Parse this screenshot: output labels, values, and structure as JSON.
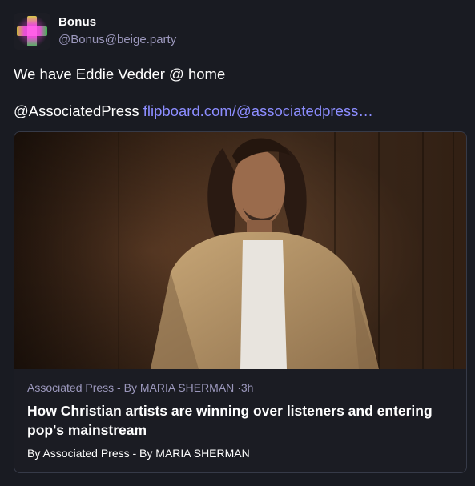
{
  "account": {
    "display_name": "Bonus",
    "handle": "@Bonus@beige.party",
    "avatar_icon": "pink-cross-avatar"
  },
  "status": {
    "line1": "We have Eddie Vedder @ home",
    "mention": "@AssociatedPress",
    "link_text": "flipboard.com/@associatedpress…"
  },
  "card": {
    "provider": "Associated Press - By MARIA SHERMAN",
    "separator": "·",
    "age": "3h",
    "title": "How Christian artists are winning over listeners and entering pop's mainstream",
    "byline": "By Associated Press - By MARIA SHERMAN"
  },
  "colors": {
    "background": "#191b22",
    "link": "#8c8dff",
    "muted": "#9c98bd",
    "card_border": "#363a48"
  }
}
